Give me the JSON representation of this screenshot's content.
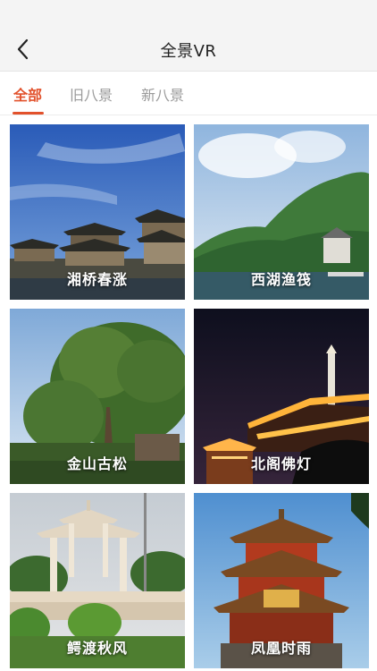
{
  "header": {
    "title": "全景VR",
    "back_icon": "chevron-left-icon"
  },
  "tabs": [
    {
      "label": "全部",
      "active": true
    },
    {
      "label": "旧八景",
      "active": false
    },
    {
      "label": "新八景",
      "active": false
    }
  ],
  "accent_color": "#e2512b",
  "scenes": [
    {
      "label": "湘桥春涨"
    },
    {
      "label": "西湖渔筏"
    },
    {
      "label": "金山古松"
    },
    {
      "label": "北阁佛灯"
    },
    {
      "label": "鳄渡秋风"
    },
    {
      "label": "凤凰时雨"
    }
  ]
}
